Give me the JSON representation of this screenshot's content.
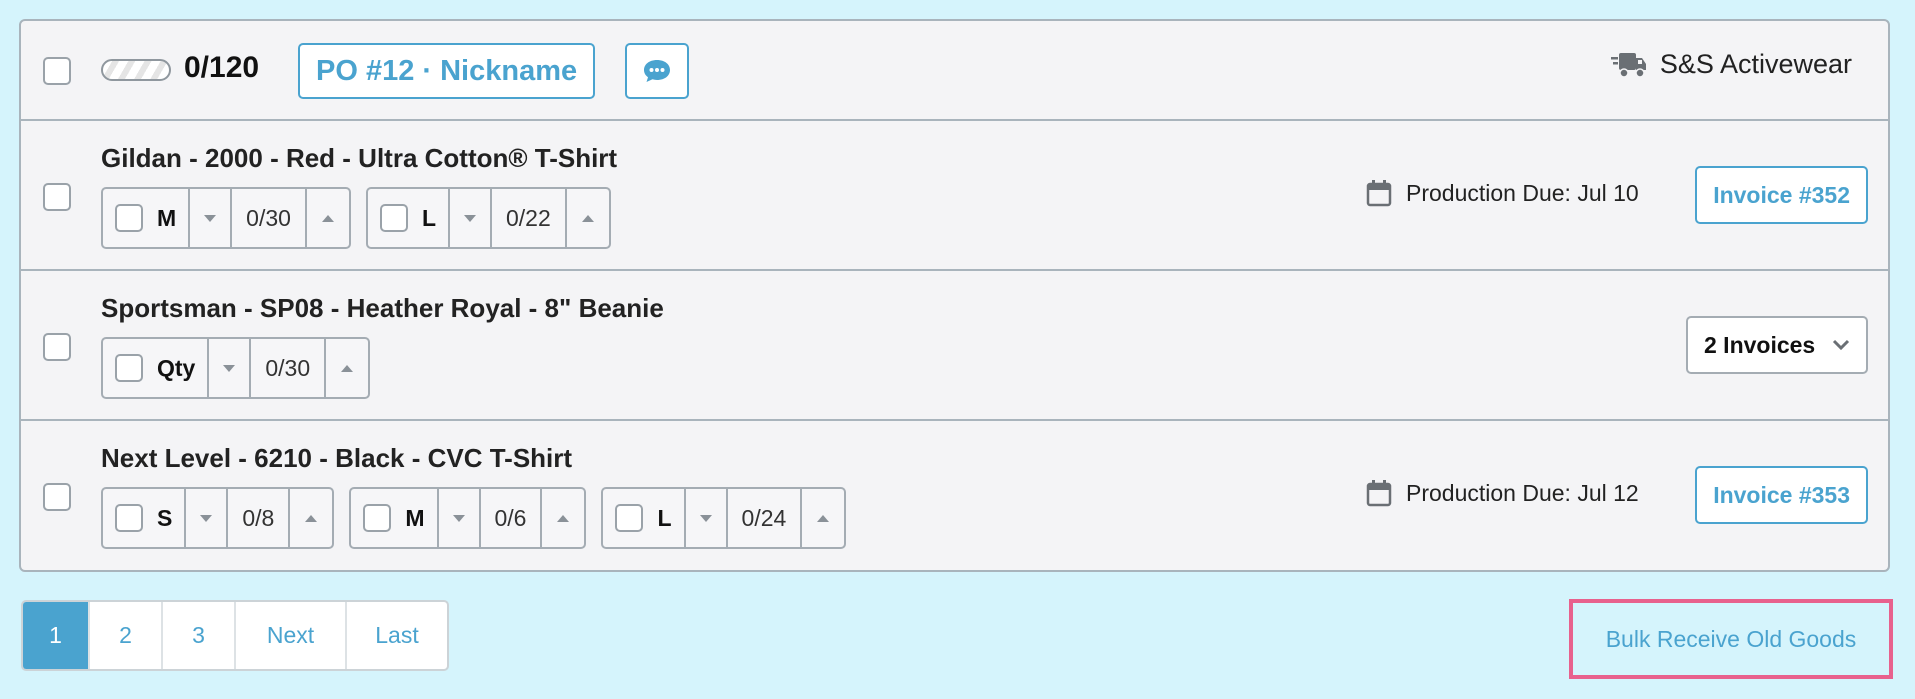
{
  "header": {
    "count": "0/120",
    "po_label": "PO #12 · Nickname",
    "vendor": "S&S Activewear",
    "progress_fraction": 0
  },
  "rows": [
    {
      "title": "Gildan - 2000 - Red - Ultra Cotton® T-Shirt",
      "sizes": [
        {
          "label": "M",
          "value": "0/30"
        },
        {
          "label": "L",
          "value": "0/22"
        }
      ],
      "due": "Production Due: Jul 10",
      "invoice": "Invoice #352"
    },
    {
      "title": "Sportsman - SP08 - Heather Royal - 8\" Beanie",
      "sizes": [
        {
          "label": "Qty",
          "value": "0/30"
        }
      ],
      "invoices_dropdown": "2 Invoices"
    },
    {
      "title": "Next Level - 6210 - Black - CVC T-Shirt",
      "sizes": [
        {
          "label": "S",
          "value": "0/8"
        },
        {
          "label": "M",
          "value": "0/6"
        },
        {
          "label": "L",
          "value": "0/24"
        }
      ],
      "due": "Production Due: Jul 12",
      "invoice": "Invoice #353"
    }
  ],
  "pagination": {
    "items": [
      "1",
      "2",
      "3",
      "Next",
      "Last"
    ],
    "active": "1"
  },
  "bulk_button": "Bulk Receive Old Goods",
  "colors": {
    "accent": "#4aa3cf",
    "background": "#d5f4fc",
    "highlight": "#e8618d"
  }
}
